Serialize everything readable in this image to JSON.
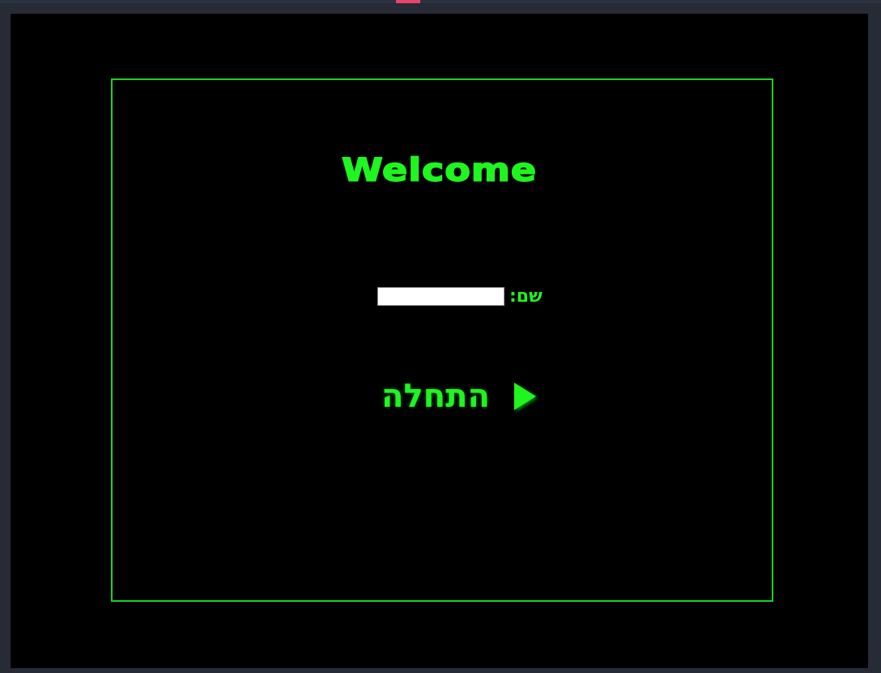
{
  "screen": {
    "title": "Welcome",
    "name_label": "שם:",
    "name_value": "",
    "start_label": "התחלה",
    "start_icon": "play-icon"
  },
  "colors": {
    "accent": "#1ff51f",
    "background": "#000000",
    "frame": "#1fd21f",
    "outer": "#262b36",
    "top_marker": "#e8436a"
  }
}
